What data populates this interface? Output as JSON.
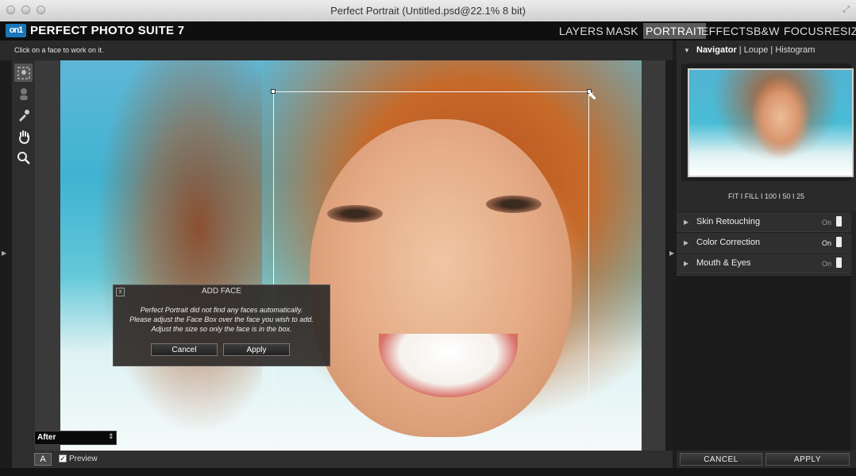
{
  "window": {
    "title": "Perfect Portrait (Untitled.psd@22.1% 8 bit)"
  },
  "app": {
    "logo_text": "on1",
    "name": "PERFECT PHOTO SUITE 7"
  },
  "tabs": [
    {
      "label": "LAYERS",
      "active": false
    },
    {
      "label": "MASK",
      "active": false
    },
    {
      "label": "PORTRAIT",
      "active": true
    },
    {
      "label": "EFFECTS",
      "active": false
    },
    {
      "label": "B&W",
      "active": false
    },
    {
      "label": "FOCUS",
      "active": false
    },
    {
      "label": "RESIZE",
      "active": false
    }
  ],
  "hint": "Click on a face to work on it.",
  "tools": [
    "face-select-icon",
    "person-icon",
    "eyedropper-icon",
    "hand-icon",
    "zoom-icon"
  ],
  "dialog": {
    "close": "x",
    "title": "ADD FACE",
    "lines": [
      "Perfect Portrait did not find any faces automatically.",
      "Please adjust the Face Box over the face you wish to add.",
      "Adjust the size so only the face is in the box."
    ],
    "cancel": "Cancel",
    "apply": "Apply"
  },
  "view_select": {
    "value": "After",
    "arrow": "⇕"
  },
  "bottom": {
    "a_button": "A",
    "preview_label": "Preview",
    "preview_checked": "✓"
  },
  "navigator": {
    "tabs": {
      "active": "Navigator",
      "sep1": " | ",
      "loupe": "Loupe",
      "sep2": " | ",
      "histogram": "Histogram"
    },
    "zoom_options": "FIT I FILL I 100 I  50  I  25",
    "zoom_fit": "FIT"
  },
  "adjustments": [
    {
      "label": "Skin Retouching",
      "state": "On"
    },
    {
      "label": "Color Correction",
      "state": "On"
    },
    {
      "label": "Mouth & Eyes",
      "state": "On"
    }
  ],
  "panel_buttons": {
    "cancel": "CANCEL",
    "apply": "APPLY"
  },
  "colors": {
    "accent": "#1877b8",
    "active_tab": "#5a5a5a",
    "panel": "#2a2a2a"
  }
}
